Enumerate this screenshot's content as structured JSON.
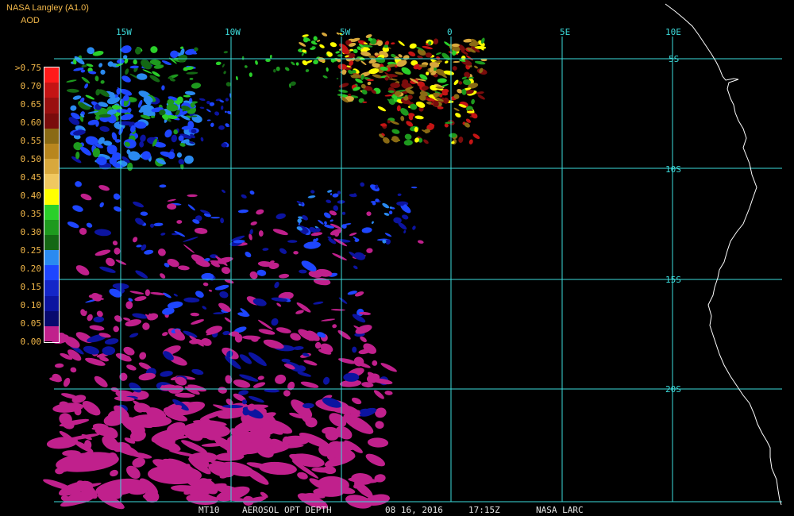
{
  "header": {
    "title": "NASA Langley (A1.0)",
    "variable": "AOD"
  },
  "legend": {
    "labels": [
      ">0.75",
      "0.70",
      "0.65",
      "0.60",
      "0.55",
      "0.50",
      "0.45",
      "0.40",
      "0.35",
      "0.30",
      "0.25",
      "0.20",
      "0.15",
      "0.10",
      "0.05",
      "0.00"
    ],
    "colors": [
      "#ff1a1a",
      "#c41414",
      "#9a1010",
      "#7a0c0c",
      "#8a6a14",
      "#b8861e",
      "#d8a83c",
      "#f0c860",
      "#ffff00",
      "#2ad02a",
      "#1e9a1e",
      "#146814",
      "#2a8af0",
      "#1e46ff",
      "#1426c8",
      "#0c14a0",
      "#080a6e",
      "#c0208c"
    ]
  },
  "map": {
    "lon_labels": [
      "15W",
      "10W",
      "5W",
      "0",
      "5E",
      "10E"
    ],
    "lat_labels": [
      "5S",
      "10S",
      "15S",
      "20S"
    ],
    "colors": {
      "grid": "#3cdcdc",
      "coast": "#ffffff",
      "label": "#3cdcdc"
    }
  },
  "footer": {
    "product": "MT10",
    "title": "AEROSOL OPT DEPTH",
    "date": "08 16, 2016",
    "time": "17:15Z",
    "org": "NASA LARC"
  }
}
